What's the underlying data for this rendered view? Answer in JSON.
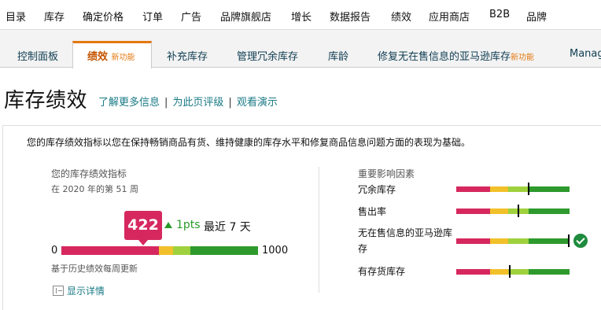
{
  "topnav": {
    "items": [
      "目录",
      "库存",
      "确定价格",
      "订单",
      "广告",
      "品牌旗舰店",
      "增长",
      "数据报告",
      "绩效",
      "应用商店",
      "B2B",
      "品牌"
    ]
  },
  "subtabs": {
    "items": [
      {
        "label": "控制面板"
      },
      {
        "label": "绩效",
        "badge": "新功能",
        "active": true
      },
      {
        "label": "补充库存"
      },
      {
        "label": "管理冗余库存"
      },
      {
        "label": "库龄"
      },
      {
        "label": "修复无在售信息的亚马逊库存",
        "badge": "新功能"
      },
      {
        "label": "Manag"
      }
    ]
  },
  "page": {
    "title": "库存绩效",
    "links": [
      "了解更多信息",
      "为此页评级",
      "观看演示"
    ],
    "separator": "|"
  },
  "panel": {
    "description": "您的库存绩效指标以您在保持畅销商品有货、维持健康的库存水平和修复商品信息问题方面的表现为基础。",
    "performance": {
      "title": "您的库存绩效指标",
      "week_text": "在 2020 年的第 51 周",
      "score": "422",
      "change": "1pts",
      "change_period": "最近 7 天",
      "min": "0",
      "max": "1000",
      "score_value": 422,
      "weekly_note": "基于历史绩效每周更新",
      "show_details": "显示详情"
    },
    "factors": {
      "title": "重要影响因素",
      "items": [
        {
          "label": "冗余库存",
          "marker_position": 0.64,
          "ok": false
        },
        {
          "label": "售出率",
          "marker_position": 0.55,
          "ok": false
        },
        {
          "label": "无在售信息的亚马逊库存",
          "marker_position": 0.99,
          "ok": true
        },
        {
          "label": "有存货库存",
          "marker_position": 0.47,
          "ok": false
        }
      ]
    }
  },
  "colors": {
    "accent": "#e47911",
    "link": "#1a7a85",
    "score_badge": "#d6285f",
    "bar_red": "#d6285f",
    "bar_yellow": "#f2c02a",
    "bar_light_green": "#9fd13e",
    "bar_green": "#2e9a2e",
    "positive": "#2a9a2a"
  }
}
